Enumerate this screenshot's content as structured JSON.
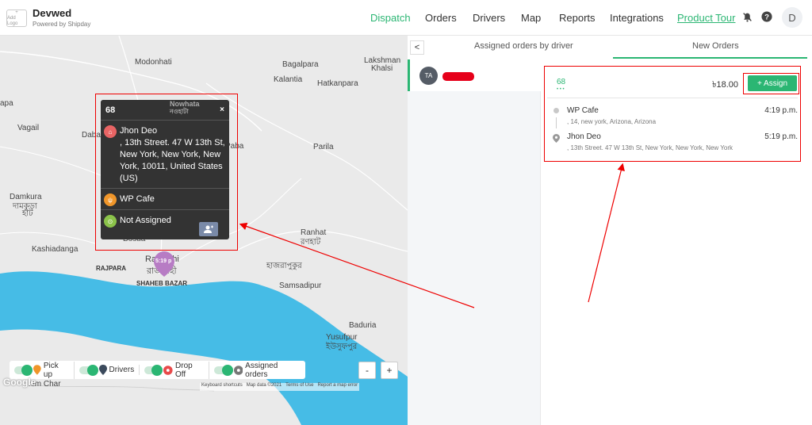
{
  "app": {
    "logo_text": "Add Logo",
    "name": "Devwed",
    "powered_by": "Powered by Shipday"
  },
  "nav": {
    "dispatch": "Dispatch",
    "orders": "Orders",
    "drivers": "Drivers",
    "map": "Map",
    "reports": "Reports",
    "integrations": "Integrations",
    "product_tour": "Product Tour",
    "user_initial": "D"
  },
  "map": {
    "labels": {
      "modonhati": "Modonhati",
      "bagalpara": "Bagalpara",
      "lakshman_khalsi": "Lakshman",
      "lakshman_khalsi2": "Khalsi",
      "kalantia": "Kalantia",
      "hatkanpara": "Hatkanpara",
      "apa": "apa",
      "vagail": "Vagail",
      "dabar": "Dabar",
      "paba": "Paba",
      "parila": "Parila",
      "damkura": "Damkura",
      "damkura_bn": "দামকুড়া",
      "hat_bn": "হাট",
      "kashiadanga": "Kashiadanga",
      "rajpara": "RAJPARA",
      "shaheb_bazar": "SHAHEB BAZAR",
      "hajrapukur": "হাজরাপুকুর",
      "samsadipur": "Samsadipur",
      "ranhat": "Ranhat",
      "ranhat_bn": "রণহাট",
      "baduria": "Baduria",
      "yusufpur": "Yusufpur",
      "yusufpur_bn": "ইউসুফপুর",
      "charim_char": "him Char",
      "bosua": "Bosua",
      "rajshahi": "Rajshahi",
      "rajshahi_bn": "রাজশাহী",
      "nowhata": "Nowhata",
      "nowhata_bn": "নওহাটা"
    },
    "marker_time": "5:19 p",
    "popup": {
      "id": "68",
      "close": "×",
      "customer": "Jhon Deo",
      "address": ", 13th Street. 47 W 13th St, New York, New York, New York, 10011, United States (US)",
      "restaurant": "WP Cafe",
      "status": "Not Assigned"
    },
    "legend": {
      "pickup": "Pick up",
      "drivers": "Drivers",
      "dropoff": "Drop Off",
      "assigned": "Assigned orders"
    },
    "zoom_out": "-",
    "zoom_in": "+",
    "google": "Google",
    "attribution": {
      "shortcuts": "Keyboard shortcuts",
      "mapdata": "Map data ©2021",
      "terms": "Terms of Use",
      "report": "Report a map error"
    }
  },
  "panel": {
    "back": "<",
    "tab_assigned": "Assigned orders by driver",
    "tab_new": "New Orders",
    "driver_initials": "TA",
    "order": {
      "id": "68",
      "price": "৳18.00",
      "assign": "+ Assign",
      "pickup_name": "WP Cafe",
      "pickup_addr": ", 14, new york, Arizona, Arizona",
      "pickup_time": "4:19 p.m.",
      "dropoff_name": "Jhon Deo",
      "dropoff_addr": ", 13th Street. 47 W 13th St, New York, New York, New York",
      "dropoff_time": "5:19 p.m."
    }
  },
  "colors": {
    "accent": "#2bb673",
    "annotation": "#e00000",
    "river": "#46bce6"
  }
}
